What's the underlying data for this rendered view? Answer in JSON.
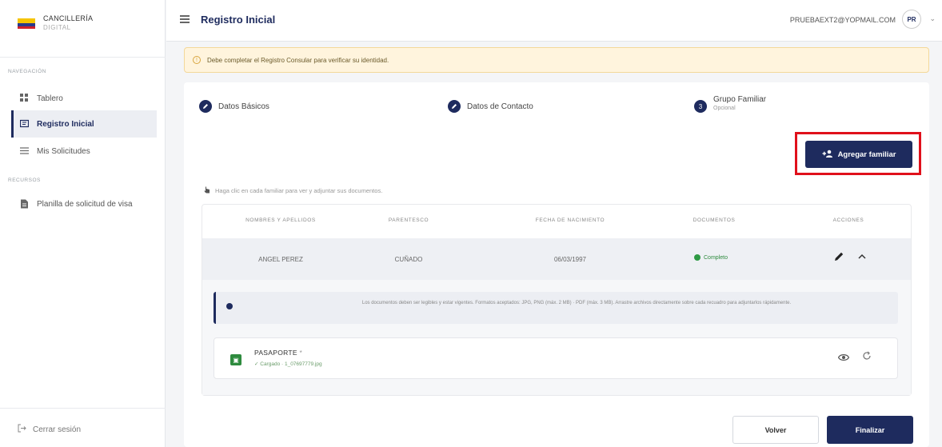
{
  "brand": {
    "title": "CANCILLERÍA",
    "subtitle": "DIGITAL"
  },
  "sidebar": {
    "nav_label": "NAVEGACIÓN",
    "resources_label": "RECURSOS",
    "items": [
      {
        "label": "Tablero",
        "icon": "grid-icon"
      },
      {
        "label": "Registro Inicial",
        "icon": "id-card-icon",
        "active": true
      },
      {
        "label": "Mis Solicitudes",
        "icon": "list-icon"
      }
    ],
    "resources": [
      {
        "label": "Planilla de solicitud de visa",
        "icon": "document-icon"
      }
    ],
    "logout_label": "Cerrar sesión"
  },
  "header": {
    "title": "Registro Inicial",
    "user_email": "PRUEBAEXT2@YOPMAIL.COM",
    "avatar_initials": "PR"
  },
  "alert": {
    "text": "Debe completar el Registro Consular para verificar su identidad."
  },
  "steps": [
    {
      "label": "Datos Básicos",
      "state": "done"
    },
    {
      "label": "Datos de Contacto",
      "state": "done"
    },
    {
      "label": "Grupo Familiar",
      "sublabel": "Opcional",
      "number": "3"
    }
  ],
  "add_family_button": "Agregar familiar",
  "hint": "Haga clic en cada familiar para ver y adjuntar sus documentos.",
  "table": {
    "headers": [
      "NOMBRES Y APELLIDOS",
      "PARENTESCO",
      "FECHA DE NACIMIENTO",
      "DOCUMENTOS",
      "ACCIONES"
    ],
    "row": {
      "name": "ANGEL PEREZ",
      "relationship": "CUÑADO",
      "birth_date": "06/03/1997",
      "status": "Completo"
    }
  },
  "info_text": "Los documentos deben ser legibles y estar vigentes. Formatos aceptados: JPG, PNG (máx. 2 MB) · PDF (máx. 3 MB). Arrastre archivos directamente sobre cada recuadro para adjuntarlos rápidamente.",
  "document": {
    "title": "PASAPORTE",
    "required_mark": "*",
    "status": "✓ Cargado · 1_07697779.jpg"
  },
  "buttons": {
    "back": "Volver",
    "finish": "Finalizar"
  },
  "colors": {
    "primary": "#1e2b5e",
    "success": "#2e9a44",
    "warning_bg": "#fff4dd",
    "highlight": "#e0101b"
  }
}
